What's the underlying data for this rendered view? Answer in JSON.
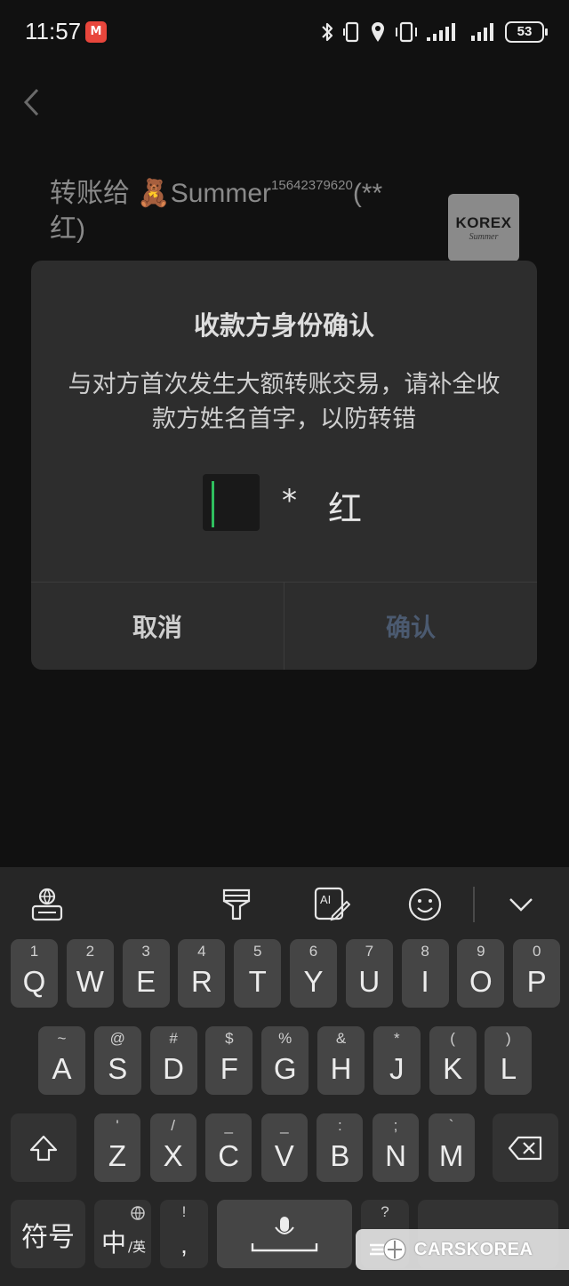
{
  "status_bar": {
    "time": "11:57",
    "carrier_badge": "M",
    "battery": "53",
    "icons": [
      "bluetooth-icon",
      "vibrate-icon",
      "location-icon",
      "vibrate-icon",
      "signal-icon",
      "signal-icon"
    ]
  },
  "page": {
    "transfer_title": "转账给 🧸Summer",
    "transfer_number": "15642379620",
    "transfer_masked": "(**",
    "transfer_masked_2": "红)",
    "brand_logo_main": "KOREX",
    "brand_logo_sub": "Summer"
  },
  "dialog": {
    "title": "收款方身份确认",
    "message": "与对方首次发生大额转账交易，请补全收款方姓名首字，以防转错",
    "input_value": "",
    "masked_star": "*",
    "known_char": "红",
    "cancel_label": "取消",
    "confirm_label": "确认",
    "accent_color": "#2fbf5e"
  },
  "keyboard": {
    "row1": [
      {
        "hint": "1",
        "key": "Q"
      },
      {
        "hint": "2",
        "key": "W"
      },
      {
        "hint": "3",
        "key": "E"
      },
      {
        "hint": "4",
        "key": "R"
      },
      {
        "hint": "5",
        "key": "T"
      },
      {
        "hint": "6",
        "key": "Y"
      },
      {
        "hint": "7",
        "key": "U"
      },
      {
        "hint": "8",
        "key": "I"
      },
      {
        "hint": "9",
        "key": "O"
      },
      {
        "hint": "0",
        "key": "P"
      }
    ],
    "row2": [
      {
        "hint": "~",
        "key": "A"
      },
      {
        "hint": "@",
        "key": "S"
      },
      {
        "hint": "#",
        "key": "D"
      },
      {
        "hint": "$",
        "key": "F"
      },
      {
        "hint": "%",
        "key": "G"
      },
      {
        "hint": "&",
        "key": "H"
      },
      {
        "hint": "*",
        "key": "J"
      },
      {
        "hint": "(",
        "key": "K"
      },
      {
        "hint": ")",
        "key": "L"
      }
    ],
    "row3": [
      {
        "hint": "'",
        "key": "Z"
      },
      {
        "hint": "/",
        "key": "X"
      },
      {
        "hint": "_",
        "key": "C"
      },
      {
        "hint": "_",
        "key": "V"
      },
      {
        "hint": ":",
        "key": "B"
      },
      {
        "hint": ";",
        "key": "N"
      },
      {
        "hint": "`",
        "key": "M"
      }
    ],
    "symbols_label": "符号",
    "lang_main": "中",
    "lang_sub": "/英",
    "comma_hint": "!",
    "comma_key": ",",
    "period_hint": "?",
    "toolbar_icons": [
      "keyboard-settings-icon",
      "brush-icon",
      "ai-edit-icon",
      "emoji-icon",
      "collapse-keyboard-icon"
    ]
  },
  "watermark": {
    "text": "CARSKOREA"
  }
}
